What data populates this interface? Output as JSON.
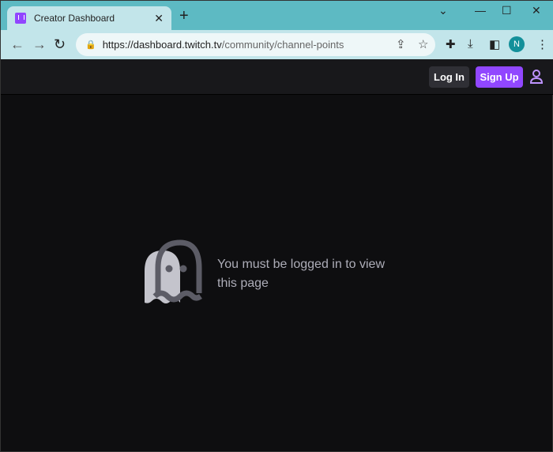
{
  "browser": {
    "tab_title": "Creator Dashboard",
    "url_host": "https://dashboard.twitch.tv",
    "url_path": "/community/channel-points",
    "profile_initial": "N"
  },
  "header": {
    "login_label": "Log In",
    "signup_label": "Sign Up"
  },
  "main": {
    "message": "You must be logged in to view this page"
  },
  "colors": {
    "accent": "#9147ff",
    "background": "#0e0e10"
  }
}
